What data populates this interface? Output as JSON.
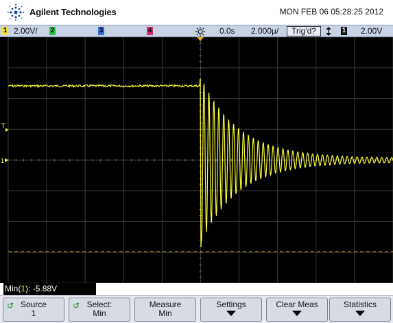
{
  "header": {
    "brand": "Agilent Technologies",
    "datetime": "MON FEB 06 05:28:25 2012",
    "logo_icon": "agilent-spark-icon"
  },
  "status_bar": {
    "ch1_number": "1",
    "ch1_scale": "2.00V/",
    "ch2_number": "2",
    "ch3_number": "3",
    "ch4_number": "4",
    "ch1_color": "#f0e040",
    "ch2_color": "#2fbf4f",
    "ch3_color": "#3a6fd6",
    "ch4_color": "#d4306e",
    "time_ref_icon": "sun-icon",
    "delay": "0.0s",
    "timebase": "2.000µ/",
    "trigger_state": "Trig'd?",
    "trigger_slope_icon": "updown-arrows-icon",
    "trigger_source": "1",
    "trigger_level": "2.00V"
  },
  "screen": {
    "trace_color": "#ffff33",
    "grid_color": "#3a3a3a",
    "marker_color": "#e8a020",
    "ground_marker": "1",
    "trigger_marker": "T"
  },
  "readout": {
    "label": "Min(",
    "channel": "1",
    "value": "): -5.88V"
  },
  "softkeys": [
    {
      "line1": "Source",
      "line2": "1",
      "icon": "rotate-knob-icon"
    },
    {
      "line1": "Select:",
      "line2": "Min",
      "icon": "rotate-knob-icon"
    },
    {
      "line1": "Measure",
      "line2": "Min"
    },
    {
      "line1": "Settings",
      "icon": "down-arrow-icon"
    },
    {
      "line1": "Clear Meas",
      "icon": "down-arrow-icon"
    },
    {
      "line1": "Statistics",
      "icon": "down-arrow-icon"
    }
  ]
}
